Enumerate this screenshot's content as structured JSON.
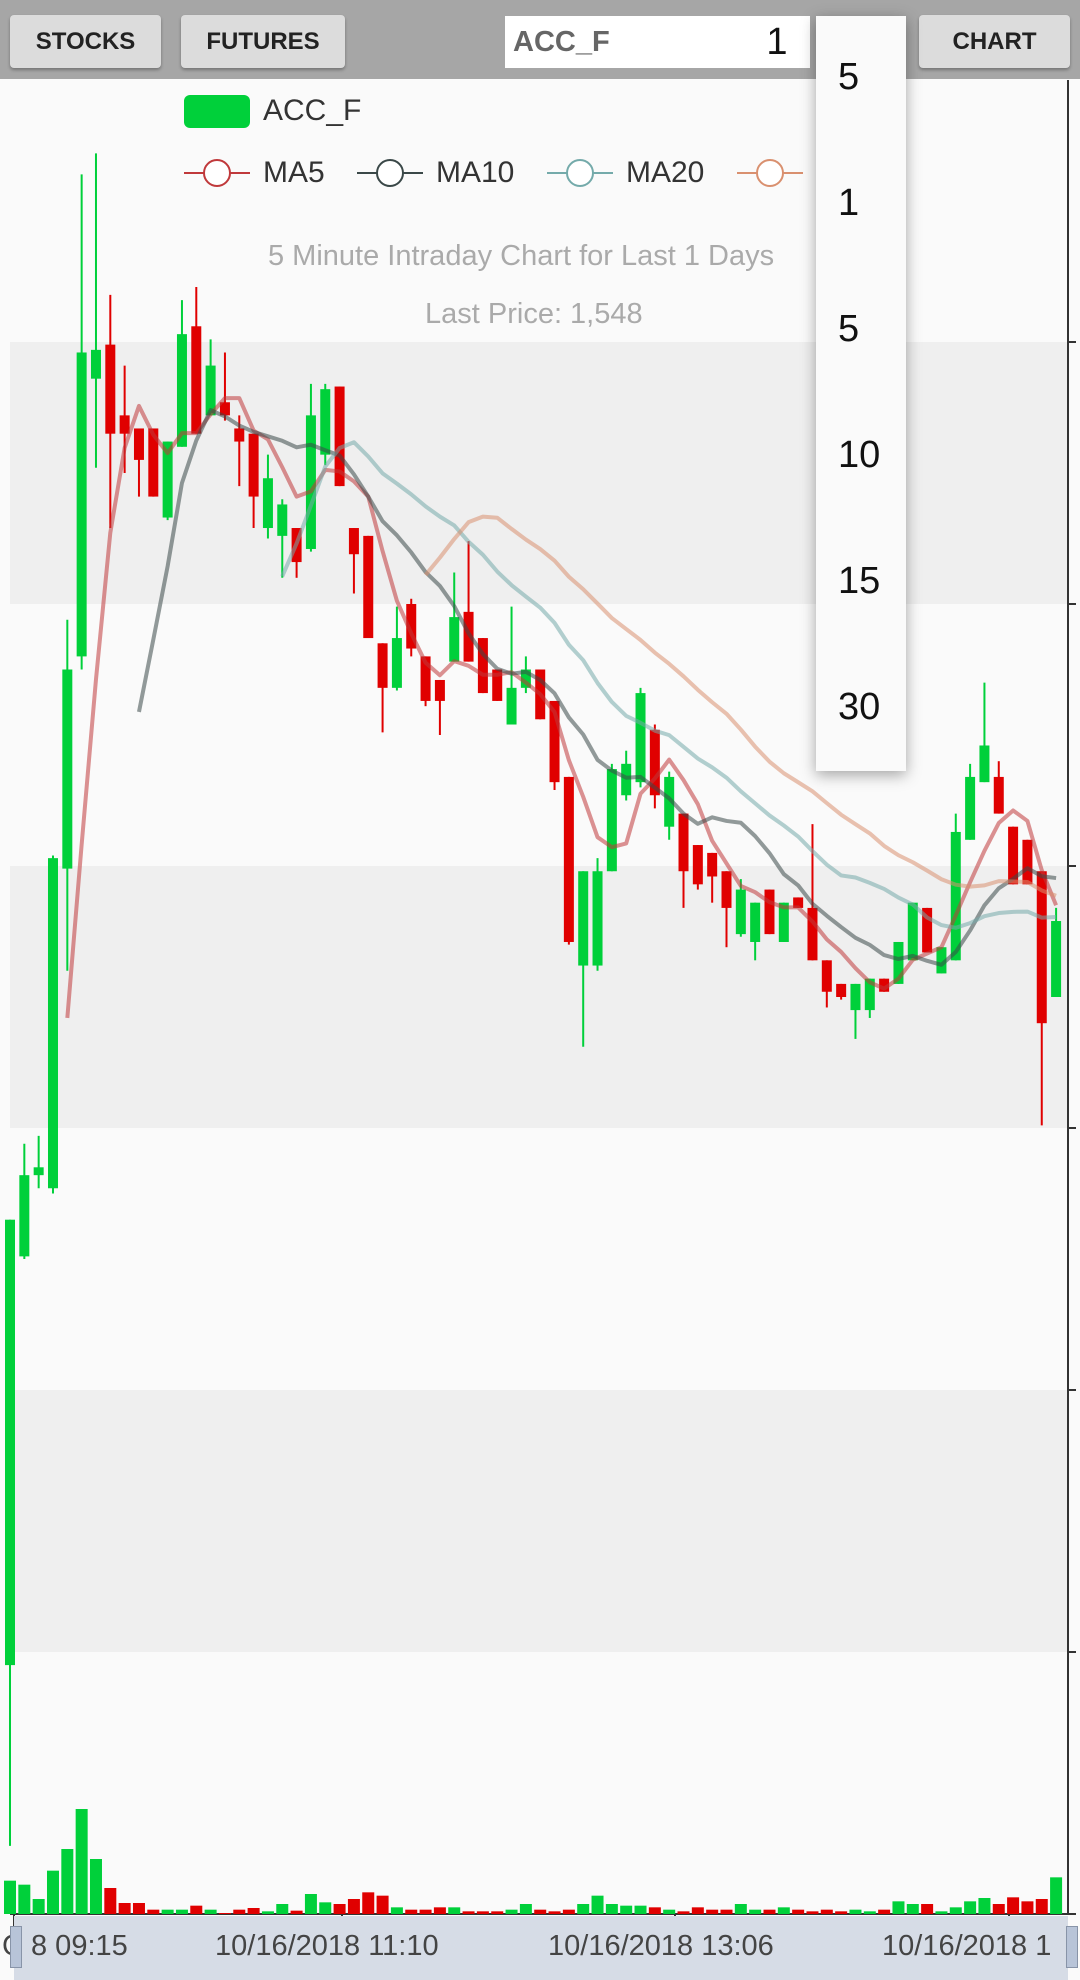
{
  "toolbar": {
    "stocks_label": "STOCKS",
    "futures_label": "FUTURES",
    "symbol_value": "ACC_F",
    "days_value": "1",
    "chart_label": "CHART"
  },
  "interval_dropdown": {
    "options": [
      "5",
      "1",
      "5",
      "10",
      "15",
      "30"
    ]
  },
  "legend": {
    "symbol": "ACC_F",
    "ma5": "MA5",
    "ma10": "MA10",
    "ma20": "MA20"
  },
  "chart_title": "5 Minute Intraday Chart for Last 1 Days",
  "last_price": "Last Price: 1,548",
  "x_labels": [
    "C 8 09:15",
    "10/16/2018 11:10",
    "10/16/2018 13:06",
    "10/16/2018 1"
  ],
  "colors": {
    "up": "#00d03a",
    "down": "#e00000",
    "ma5": "#c0393b",
    "ma10": "#3a4848",
    "ma20": "#74aaaa",
    "ma30": "#d9906f",
    "toolbar": "#a6a6a6"
  },
  "chart_data": {
    "type": "candlestick",
    "title": "5 Minute Intraday Chart for Last 1 Days",
    "ylim": [
      1510,
      1580
    ],
    "grid": true,
    "moving_averages": [
      5,
      10,
      20,
      30
    ],
    "ohlc": [
      [
        1519.5,
        1536.5,
        1512.6,
        1536.5
      ],
      [
        1535.1,
        1539.4,
        1535,
        1538.2
      ],
      [
        1538.2,
        1539.7,
        1537.7,
        1538.5
      ],
      [
        1537.7,
        1550.4,
        1537.5,
        1550.3
      ],
      [
        1549.9,
        1559.4,
        1546,
        1557.5
      ],
      [
        1558,
        1576.4,
        1557.5,
        1569.6
      ],
      [
        1568.6,
        1577.2,
        1565.2,
        1569.7
      ],
      [
        1569.9,
        1571.8,
        1562.9,
        1566.5
      ],
      [
        1567.2,
        1569.1,
        1565,
        1566.5
      ],
      [
        1566.7,
        1566.7,
        1564.1,
        1565.5
      ],
      [
        1566.7,
        1566.7,
        1564.1,
        1564.1
      ],
      [
        1563.3,
        1566.2,
        1563.2,
        1566.2
      ],
      [
        1566,
        1571.6,
        1566,
        1570.3
      ],
      [
        1570.6,
        1572.1,
        1566.5,
        1566.5
      ],
      [
        1567.2,
        1570.1,
        1567.2,
        1569.1
      ],
      [
        1567.7,
        1569.6,
        1567,
        1567.2
      ],
      [
        1566.7,
        1567.2,
        1564.5,
        1566.2
      ],
      [
        1566.5,
        1566.5,
        1562.9,
        1564.1
      ],
      [
        1562.9,
        1565.7,
        1562.5,
        1564.8
      ],
      [
        1562.6,
        1564,
        1561,
        1563.8
      ],
      [
        1562.9,
        1562.9,
        1561,
        1561.6
      ],
      [
        1562.1,
        1568.4,
        1562,
        1567.2
      ],
      [
        1565.7,
        1568.4,
        1565.3,
        1568.2
      ],
      [
        1568.3,
        1568.3,
        1564.5,
        1564.5
      ],
      [
        1562.9,
        1562.9,
        1560.4,
        1561.9
      ],
      [
        1562.6,
        1562.6,
        1558.7,
        1558.7
      ],
      [
        1558.5,
        1558.5,
        1555.1,
        1556.8
      ],
      [
        1556.8,
        1559.9,
        1556.7,
        1558.7
      ],
      [
        1560,
        1560.2,
        1558,
        1558.3
      ],
      [
        1558,
        1558,
        1556.1,
        1556.3
      ],
      [
        1557.1,
        1557.1,
        1555,
        1556.3
      ],
      [
        1557.8,
        1561.2,
        1557.8,
        1559.5
      ],
      [
        1559.7,
        1562.4,
        1557.8,
        1557.8
      ],
      [
        1558.7,
        1558.7,
        1556.6,
        1556.6
      ],
      [
        1557.5,
        1557.5,
        1556.3,
        1556.3
      ],
      [
        1555.4,
        1559.9,
        1555.4,
        1556.8
      ],
      [
        1556.8,
        1558,
        1556.6,
        1557.5
      ],
      [
        1557.5,
        1557.5,
        1555.6,
        1555.6
      ],
      [
        1556.3,
        1556.3,
        1552.9,
        1553.2
      ],
      [
        1553.4,
        1553.4,
        1547,
        1547.1
      ],
      [
        1546.2,
        1549.8,
        1543.1,
        1549.8
      ],
      [
        1546.2,
        1550.3,
        1546,
        1549.8
      ],
      [
        1549.8,
        1553.9,
        1549.8,
        1553.7
      ],
      [
        1552.7,
        1554.4,
        1552.5,
        1553.9
      ],
      [
        1553.2,
        1556.8,
        1553,
        1556.6
      ],
      [
        1555.2,
        1555.4,
        1552.2,
        1552.7
      ],
      [
        1551.5,
        1553.6,
        1551,
        1553.4
      ],
      [
        1552,
        1552,
        1548.4,
        1549.8
      ],
      [
        1550.8,
        1550.8,
        1549.1,
        1549.3
      ],
      [
        1550.5,
        1550.5,
        1548.6,
        1549.6
      ],
      [
        1549.8,
        1549.8,
        1546.9,
        1548.4
      ],
      [
        1547.4,
        1549.5,
        1547.3,
        1549.1
      ],
      [
        1547.1,
        1548.6,
        1546.4,
        1548.6
      ],
      [
        1549.1,
        1549.1,
        1547.4,
        1547.4
      ],
      [
        1547.1,
        1548.6,
        1547.1,
        1548.6
      ],
      [
        1548.8,
        1548.8,
        1548.4,
        1548.4
      ],
      [
        1548.4,
        1551.6,
        1546.4,
        1546.4
      ],
      [
        1546.4,
        1546.4,
        1544.6,
        1545.2
      ],
      [
        1545.5,
        1545.5,
        1544.9,
        1545
      ],
      [
        1544.5,
        1545.5,
        1543.4,
        1545.5
      ],
      [
        1544.5,
        1545.7,
        1544.2,
        1545.7
      ],
      [
        1545.7,
        1545.7,
        1545.2,
        1545.2
      ],
      [
        1545.5,
        1547.1,
        1545.5,
        1547.1
      ],
      [
        1546.4,
        1548.6,
        1546.4,
        1548.6
      ],
      [
        1548.4,
        1548.4,
        1546.7,
        1546.7
      ],
      [
        1545.9,
        1546.9,
        1545.9,
        1546.9
      ],
      [
        1546.4,
        1552,
        1546.4,
        1551.3
      ],
      [
        1551,
        1553.9,
        1551,
        1553.4
      ],
      [
        1553.2,
        1557,
        1553.2,
        1554.6
      ],
      [
        1553.4,
        1554,
        1552,
        1552
      ],
      [
        1551.5,
        1551.5,
        1549.3,
        1549.3
      ],
      [
        1551,
        1551,
        1549.3,
        1549.3
      ],
      [
        1549.8,
        1549.8,
        1540.1,
        1544
      ],
      [
        1545,
        1548.4,
        1545,
        1547.9
      ]
    ],
    "volume": [
      100,
      88,
      45,
      130,
      195,
      315,
      165,
      78,
      33,
      33,
      13,
      13,
      13,
      25,
      13,
      3,
      13,
      18,
      8,
      30,
      10,
      60,
      35,
      30,
      45,
      65,
      55,
      20,
      13,
      13,
      20,
      20,
      8,
      8,
      8,
      13,
      30,
      13,
      8,
      13,
      30,
      55,
      30,
      25,
      25,
      20,
      13,
      8,
      20,
      13,
      13,
      30,
      13,
      13,
      20,
      13,
      8,
      13,
      8,
      13,
      8,
      13,
      38,
      30,
      30,
      8,
      20,
      38,
      48,
      30,
      50,
      38,
      45,
      110
    ]
  }
}
